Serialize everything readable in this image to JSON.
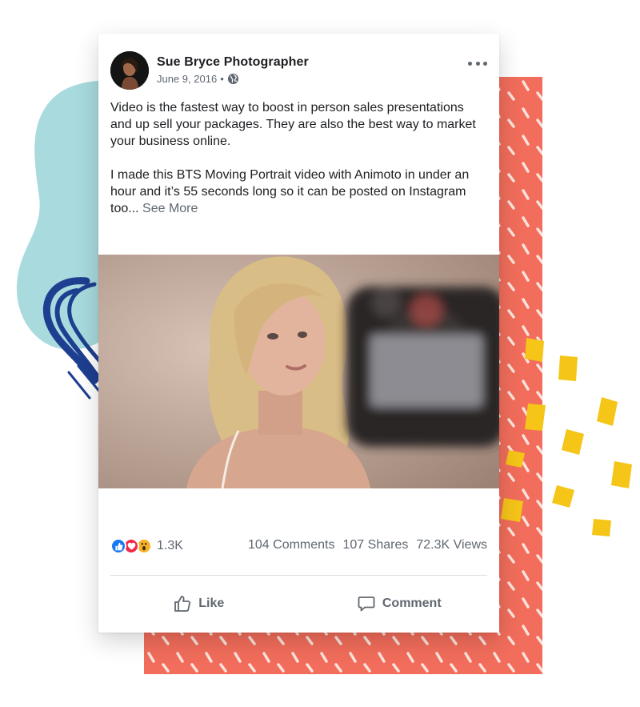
{
  "post": {
    "author": "Sue Bryce Photographer",
    "date": "June 9, 2016",
    "separator": "•",
    "privacy_icon": "globe-icon",
    "paragraph_1": "Video is the fastest way to boost in person sales presentations and up sell your packages. They are also the best way to market your business online.",
    "paragraph_2": "I made this BTS Moving Portrait video with Animoto in under an hour and it’s 55 seconds long so it can be posted on Instagram too...",
    "see_more": "See More"
  },
  "stats": {
    "reaction_icons": [
      "like-icon",
      "love-icon",
      "wow-icon"
    ],
    "reaction_count": "1.3K",
    "comments": "104 Comments",
    "shares": "107 Shares",
    "views": "72.3K Views"
  },
  "actions": {
    "like_label": "Like",
    "comment_label": "Comment"
  },
  "colors": {
    "coral": "#f26d5b",
    "teal": "#a8dade",
    "navy": "#1e3f8f",
    "yellow": "#f5c518",
    "like_blue": "#1877f2",
    "love_red": "#f0284a",
    "wow_yellow": "#f7b125"
  }
}
